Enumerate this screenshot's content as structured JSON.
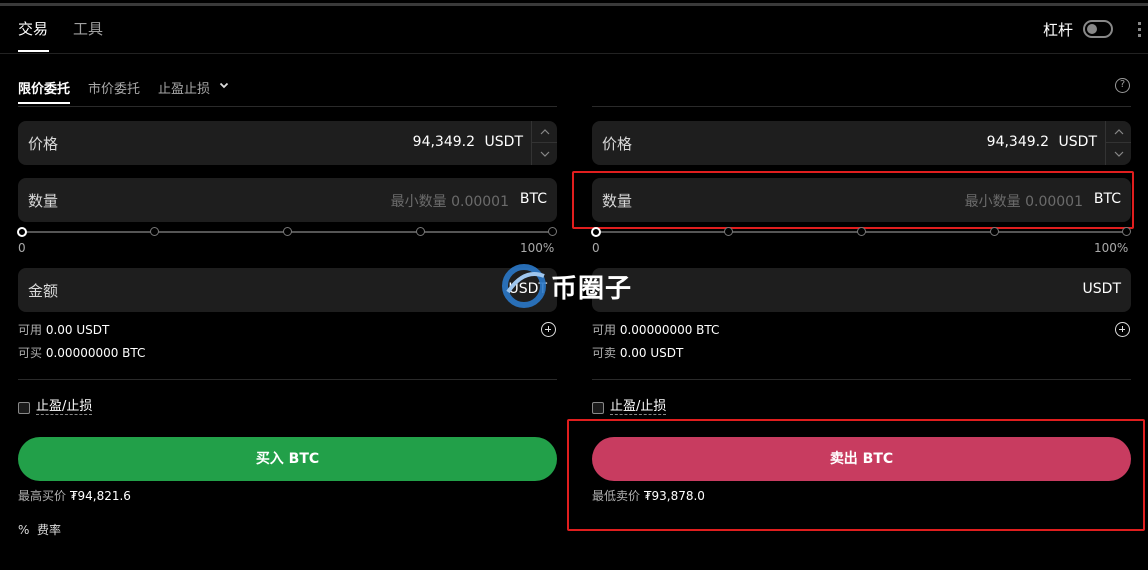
{
  "tabs": {
    "trade": "交易",
    "tools": "工具"
  },
  "leverage": {
    "label": "杠杆",
    "enabled": false
  },
  "order_types": {
    "limit": "限价委托",
    "market": "市价委托",
    "tpsl": "止盈止损"
  },
  "buy": {
    "price_label": "价格",
    "price_value": "94,349.2",
    "price_unit": "USDT",
    "qty_label": "数量",
    "qty_placeholder": "最小数量 0.00001",
    "qty_unit": "BTC",
    "slider_min": "0",
    "slider_max": "100%",
    "amount_label": "金额",
    "amount_unit": "USDT",
    "avail_label": "可用",
    "avail_value": "0.00 USDT",
    "can_label": "可买",
    "can_value": "0.00000000 BTC",
    "tpsl_label": "止盈/止损",
    "button": "买入 BTC",
    "best_label": "最高买价",
    "best_value": "₮94,821.6"
  },
  "sell": {
    "price_label": "价格",
    "price_value": "94,349.2",
    "price_unit": "USDT",
    "qty_label": "数量",
    "qty_placeholder": "最小数量 0.00001",
    "qty_unit": "BTC",
    "slider_min": "0",
    "slider_max": "100%",
    "amount_unit": "USDT",
    "avail_label": "可用",
    "avail_value": "0.00000000 BTC",
    "can_label": "可卖",
    "can_value": "0.00 USDT",
    "tpsl_label": "止盈/止损",
    "button": "卖出 BTC",
    "best_label": "最低卖价",
    "best_value": "₮93,878.0"
  },
  "fee": {
    "icon": "%",
    "label": "费率"
  },
  "watermark": "币圈子",
  "colors": {
    "buy": "#22a049",
    "sell": "#c83c60",
    "highlight": "#e01e1e"
  }
}
